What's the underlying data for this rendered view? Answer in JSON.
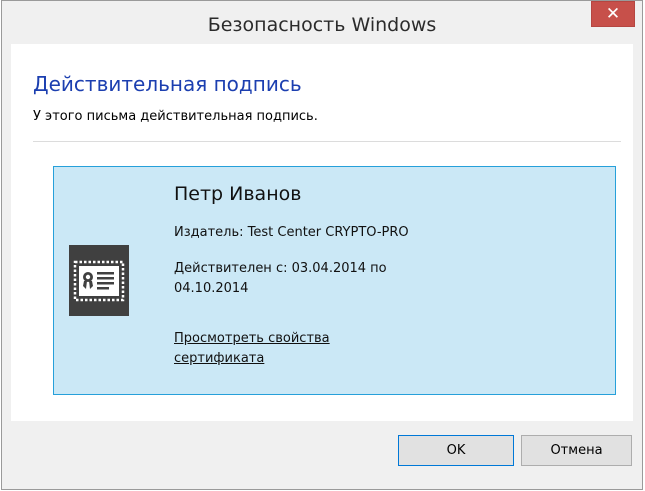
{
  "window": {
    "title": "Безопасность Windows",
    "close_glyph": "✕"
  },
  "header": {
    "heading": "Действительная подпись",
    "description": "У этого письма действительная подпись."
  },
  "certificate": {
    "icon": "certificate-icon",
    "owner": "Петр Иванов",
    "issuer": "Издатель: Test Center CRYPTO-PRO",
    "validity": "Действителен с: 03.04.2014 по 04.10.2014",
    "view_link": "Просмотреть свойства сертификата"
  },
  "buttons": {
    "ok": "OK",
    "cancel": "Отмена"
  },
  "colors": {
    "heading": "#1c3fb0",
    "cert_bg": "#cbe8f6",
    "cert_border": "#26a0da",
    "close_bg": "#c7504a"
  }
}
